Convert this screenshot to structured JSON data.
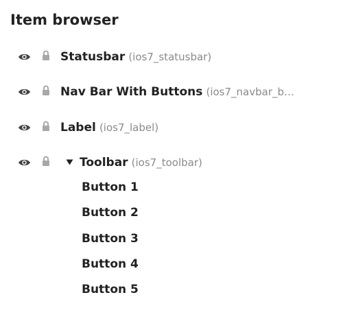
{
  "panel": {
    "title": "Item browser"
  },
  "items": [
    {
      "name": "Statusbar",
      "id": "(ios7_statusbar)"
    },
    {
      "name": "Nav Bar With Buttons",
      "id": "(ios7_navbar_b…"
    },
    {
      "name": "Label",
      "id": "(ios7_label)"
    },
    {
      "name": "Toolbar",
      "id": "(ios7_toolbar)"
    }
  ],
  "toolbar_children": [
    "Button 1",
    "Button 2",
    "Button 3",
    "Button 4",
    "Button 5"
  ],
  "icons": {
    "visibility": "eye-icon",
    "lock": "lock-icon",
    "expand": "caret-down-icon"
  },
  "colors": {
    "text": "#222222",
    "secondary_text": "#8a8a8a",
    "icon": "#444444",
    "lock_icon": "#a8a8a8"
  }
}
